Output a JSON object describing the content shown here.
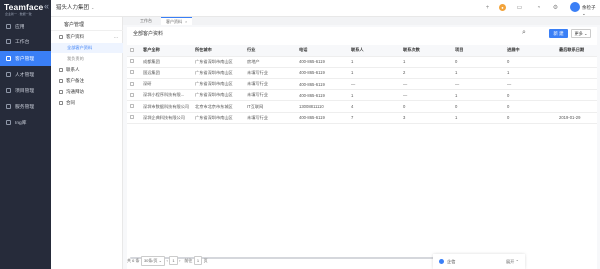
{
  "brand": {
    "name": "Teamface",
    "tagline": "企业新一 · 数据一致"
  },
  "nav": {
    "items": [
      {
        "label": "应用",
        "active": false
      },
      {
        "label": "工作台",
        "active": false
      },
      {
        "label": "客户管理",
        "active": true
      },
      {
        "label": "人才管理",
        "active": false
      },
      {
        "label": "项目管理",
        "active": false
      },
      {
        "label": "服务管理",
        "active": false
      },
      {
        "label": "Ing库",
        "active": false
      }
    ]
  },
  "header": {
    "company": "猎头人力集团",
    "user": "余检子"
  },
  "sub": {
    "title": "客户管理",
    "items": [
      {
        "label": "客户资料",
        "child": false,
        "selected": false,
        "more": "..."
      },
      {
        "label": "全部客户资料",
        "child": true,
        "selected": true
      },
      {
        "label": "我负责的",
        "child": true,
        "selected": false
      },
      {
        "label": "联系人",
        "child": false,
        "selected": false
      },
      {
        "label": "客户备注",
        "child": false,
        "selected": false
      },
      {
        "label": "沟通拜访",
        "child": false,
        "selected": false
      },
      {
        "label": "合同",
        "child": false,
        "selected": false
      }
    ]
  },
  "tabs": [
    {
      "label": "工作台"
    },
    {
      "label": "客户资料",
      "close": "×"
    }
  ],
  "panel": {
    "title": "全部客户资料",
    "new_label": "新 建",
    "more_label": "更多 ⌄"
  },
  "table": {
    "columns": [
      "客户全称",
      "所在城市",
      "行业",
      "电话",
      "联系人",
      "联系次数",
      "项目",
      "进展中",
      "最后联系日期"
    ],
    "rows": [
      [
        "成都集团",
        "广东省深圳市南山区",
        "房地产",
        "400-865-6119",
        "1",
        "1",
        "0",
        "0",
        ""
      ],
      [
        "国远集团",
        "广东省深圳市南山区",
        "未填写行业",
        "400-865-6119",
        "1",
        "2",
        "1",
        "1",
        ""
      ],
      [
        "深研",
        "广东省深圳市南山区",
        "未填写行业",
        "400-865-6119",
        "—",
        "—",
        "—",
        "—",
        ""
      ],
      [
        "深圳小程序科技有限...",
        "广东省深圳市南山区",
        "未填写行业",
        "400-865-6119",
        "1",
        "—",
        "1",
        "0",
        ""
      ],
      [
        "深圳市数据科技有限公司",
        "北京市北京市东城区",
        "IT互联网",
        "13008811110",
        "4",
        "0",
        "0",
        "0",
        ""
      ],
      [
        "深圳企典科技有限公司",
        "广东省深圳市南山区",
        "未填写行业",
        "400-865-6119",
        "7",
        "3",
        "1",
        "0",
        "2019-01-29"
      ]
    ]
  },
  "footer": {
    "total": "共 6 条",
    "page_size": "30条/页",
    "page": "1",
    "goto_label": "前往",
    "goto_value": "1",
    "page_suffix": "页"
  },
  "chat": {
    "label": "企信",
    "expand": "展开 ⌃"
  }
}
